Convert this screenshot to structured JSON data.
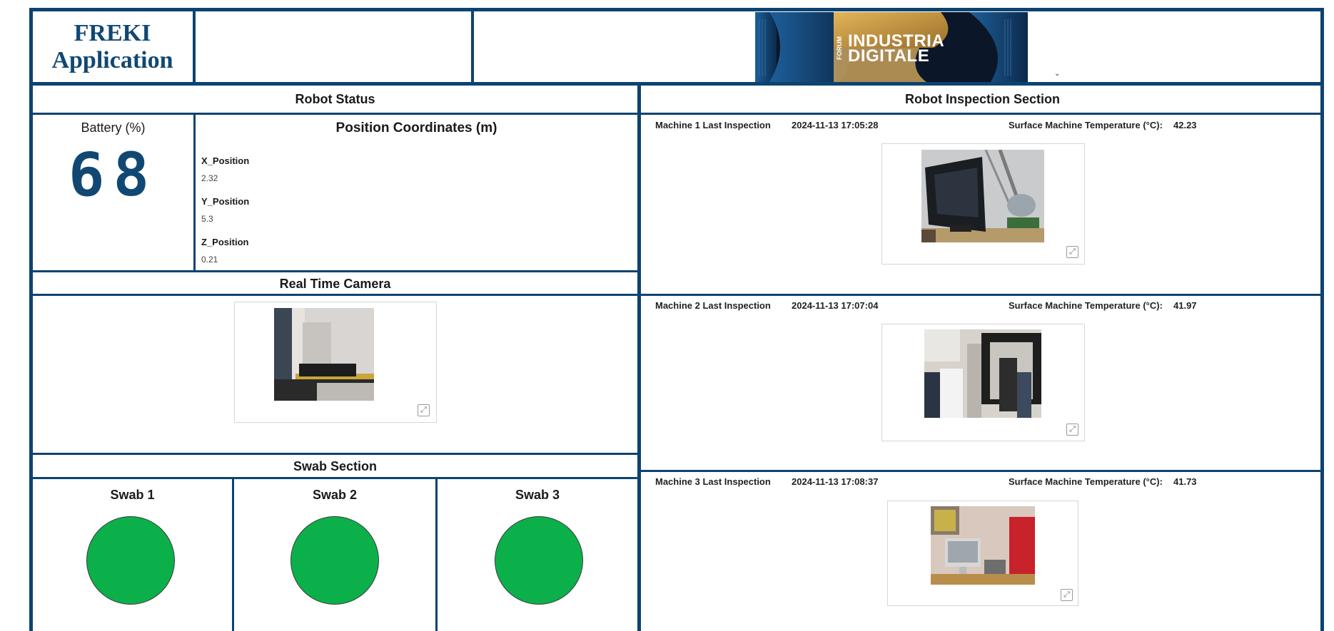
{
  "header": {
    "title_line1": "FREKI",
    "title_line2": "Application",
    "banner": {
      "side_text": "FORUM",
      "line1": "INDUSTRIA",
      "line2": "DIGITALE"
    }
  },
  "robot_status": {
    "title": "Robot Status",
    "battery_label": "Battery (%)",
    "battery_value": "68",
    "position_title": "Position Coordinates (m)",
    "positions": [
      {
        "label": "X_Position",
        "value": "2.32"
      },
      {
        "label": "Y_Position",
        "value": "5.3"
      },
      {
        "label": "Z_Position",
        "value": "0.21"
      }
    ]
  },
  "camera": {
    "title": "Real Time Camera"
  },
  "swab_section": {
    "title": "Swab Section",
    "color": "#0cb04a",
    "swabs": [
      {
        "label": "Swab 1"
      },
      {
        "label": "Swab 2"
      },
      {
        "label": "Swab 3"
      }
    ]
  },
  "inspection": {
    "title": "Robot Inspection Section",
    "temp_label": "Surface Machine Temperature (°C):",
    "machines": [
      {
        "label": "Machine 1 Last Inspection",
        "timestamp": "2024-11-13 17:05:28",
        "temp": "42.23"
      },
      {
        "label": "Machine 2 Last Inspection",
        "timestamp": "2024-11-13 17:07:04",
        "temp": "41.97"
      },
      {
        "label": "Machine 3 Last Inspection",
        "timestamp": "2024-11-13 17:08:37",
        "temp": "41.73"
      }
    ]
  },
  "colors": {
    "border": "#0d4370",
    "title_blue": "#114873",
    "swab_green": "#0cb04a"
  }
}
